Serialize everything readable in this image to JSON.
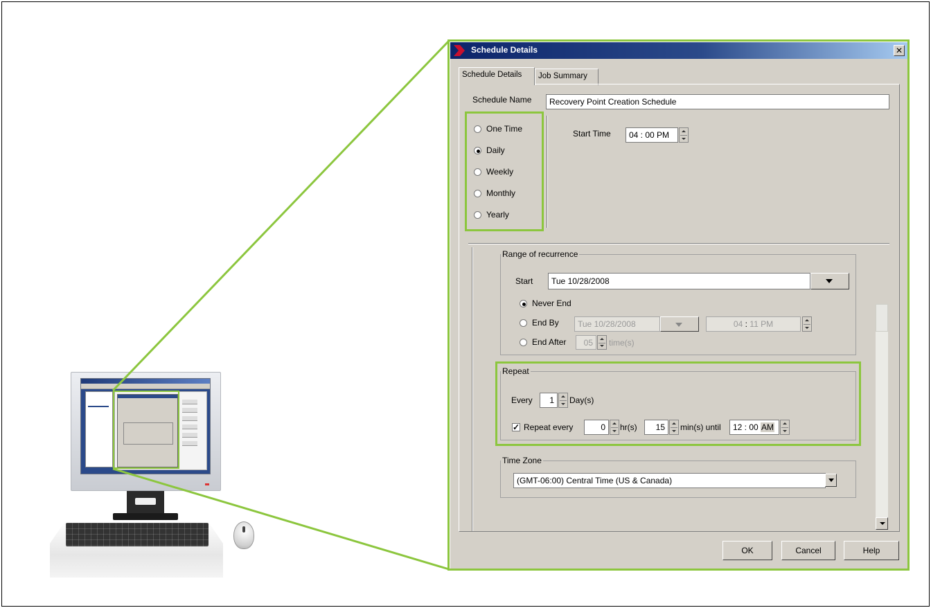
{
  "dialog": {
    "title": "Schedule Details",
    "close_label": "✕",
    "tabs": [
      "Schedule Details",
      "Job Summary"
    ],
    "schedule_name_label": "Schedule Name",
    "schedule_name_value": "Recovery Point Creation Schedule",
    "frequency_options": [
      "One Time",
      "Daily",
      "Weekly",
      "Monthly",
      "Yearly"
    ],
    "frequency_selected": "Daily",
    "start_time_label": "Start Time",
    "start_time_value": "04 : 00 PM",
    "range": {
      "title": "Range of recurrence",
      "start_label": "Start",
      "start_value": "Tue 10/28/2008",
      "never_end_label": "Never End",
      "end_by_label": "End By",
      "end_by_date": "Tue 10/28/2008",
      "end_by_hour": "04",
      "end_by_sep": ":",
      "end_by_rest": "11 PM",
      "end_after_label": "End After",
      "end_after_value": "05",
      "end_after_unit": "time(s)",
      "selected": "Never End"
    },
    "repeat": {
      "title": "Repeat",
      "every_label": "Every",
      "every_value": "1",
      "every_unit": "Day(s)",
      "repeat_every_label": "Repeat every",
      "repeat_checked": true,
      "check_mark": "✓",
      "hours_value": "0",
      "hours_unit": "hr(s)",
      "minutes_value": "15",
      "minutes_unit": "min(s) until",
      "until_value": "12 : 00",
      "until_ampm": "AM"
    },
    "timezone": {
      "title": "Time Zone",
      "value": "(GMT-06:00) Central Time (US & Canada)"
    },
    "buttons": {
      "ok": "OK",
      "cancel": "Cancel",
      "help": "Help"
    }
  },
  "colors": {
    "highlight": "#8cc63e",
    "titlebar": "#0c246a",
    "dialog_bg": "#d4d0c8",
    "logo": "#c8102e"
  },
  "icons": {
    "logo": "red-chevron-icon",
    "close": "close-icon",
    "spinner": "spinner-arrows-icon",
    "dropdown": "dropdown-arrow-icon"
  }
}
